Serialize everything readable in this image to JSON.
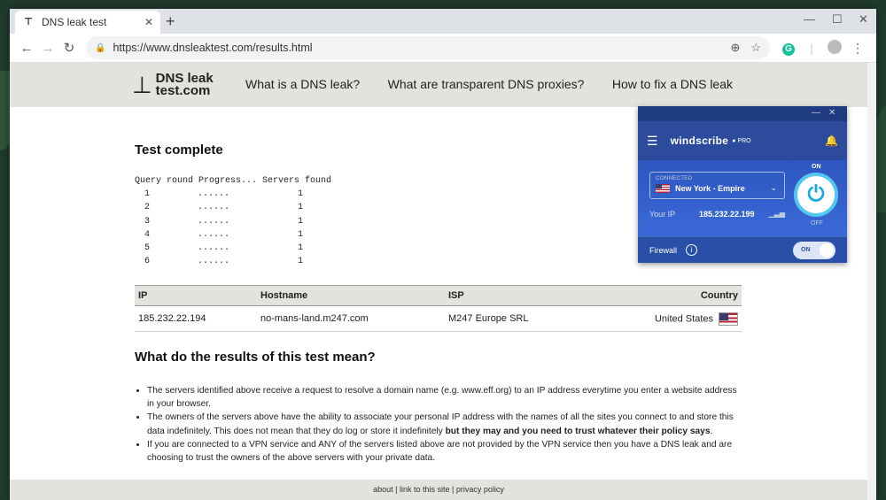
{
  "browser": {
    "tab_title": "DNS leak test",
    "url": "https://www.dnsleaktest.com/results.html",
    "window_controls": [
      "—",
      "☐",
      "✕"
    ]
  },
  "site": {
    "logo_line1": "DNS leak",
    "logo_line2": "test.com",
    "nav": [
      "What is a DNS leak?",
      "What are transparent DNS proxies?",
      "How to fix a DNS leak"
    ]
  },
  "test": {
    "title": "Test complete",
    "header": "Query round Progress... Servers found",
    "rounds": [
      {
        "round": "1",
        "progress": "......",
        "servers": "1"
      },
      {
        "round": "2",
        "progress": "......",
        "servers": "1"
      },
      {
        "round": "3",
        "progress": "......",
        "servers": "1"
      },
      {
        "round": "4",
        "progress": "......",
        "servers": "1"
      },
      {
        "round": "5",
        "progress": "......",
        "servers": "1"
      },
      {
        "round": "6",
        "progress": "......",
        "servers": "1"
      }
    ]
  },
  "results": {
    "columns": [
      "IP",
      "Hostname",
      "ISP",
      "Country"
    ],
    "rows": [
      {
        "ip": "185.232.22.194",
        "hostname": "no-mans-land.m247.com",
        "isp": "M247 Europe SRL",
        "country": "United States"
      }
    ]
  },
  "explain": {
    "title": "What do the results of this test mean?",
    "items": [
      "The servers identified above receive a request to resolve a domain name (e.g. www.eff.org) to an IP address everytime you enter a website address in your browser.",
      "The owners of the servers above have the ability to associate your personal IP address with the names of all the sites you connect to and store this data indefinitely. This does not mean that they do log or store it indefinitely ",
      "If you are connected to a VPN service and ANY of the servers listed above are not provided by the VPN service then you have a DNS leak and are choosing to trust the owners of the above servers with your private data."
    ],
    "bold_part": "but they may and you need to trust whatever their policy says",
    "item2_end": "."
  },
  "footer": {
    "about": "about",
    "link": "link to this site",
    "privacy": "privacy policy",
    "sep": " | "
  },
  "windscribe": {
    "brand": "windscribe",
    "pro": "PRO",
    "connected_label": "CONNECTED",
    "location": "New York - Empire",
    "ip_label": "Your IP",
    "ip": "185.232.22.199",
    "on": "ON",
    "off": "OFF",
    "firewall": "Firewall",
    "toggle": "ON"
  }
}
